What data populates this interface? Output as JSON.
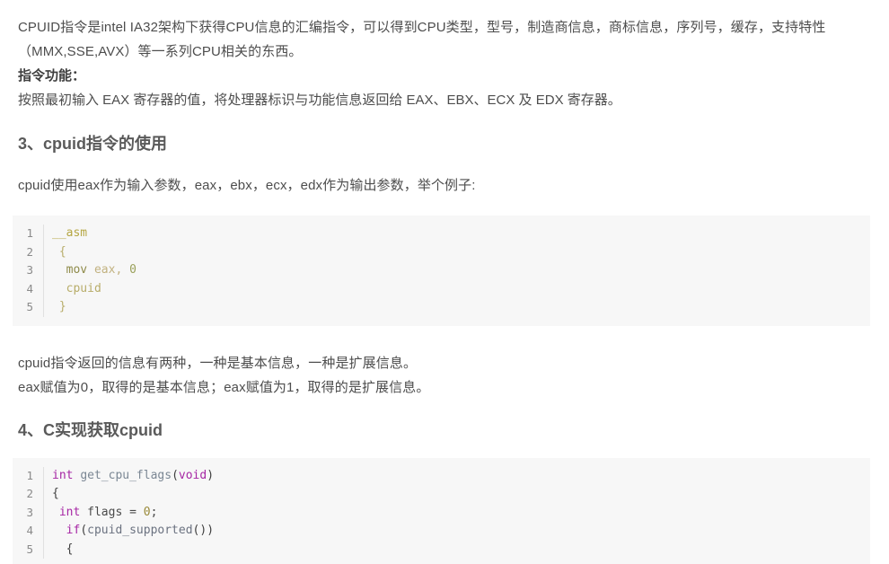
{
  "document": {
    "intro_paragraph": "CPUID指令是intel IA32架构下获得CPU信息的汇编指令，可以得到CPU类型，型号，制造商信息，商标信息，序列号，缓存，支持特性（MMX,SSE,AVX）等一系列CPU相关的东西。",
    "function_label": "指令功能：",
    "function_description": "按照最初输入 EAX 寄存器的值，将处理器标识与功能信息返回给 EAX、EBX、ECX 及 EDX 寄存器。",
    "section3": {
      "heading": "3、cpuid指令的使用",
      "paragraph": "cpuid使用eax作为输入参数，eax，ebx，ecx，edx作为输出参数，举个例子:",
      "code": {
        "language": "asm",
        "lines": [
          {
            "num": "1",
            "tokens": [
              {
                "t": "__asm",
                "c": "tk-asm-pre"
              }
            ]
          },
          {
            "num": "2",
            "tokens": [
              {
                "t": " {",
                "c": "tk-brace"
              }
            ]
          },
          {
            "num": "3",
            "tokens": [
              {
                "t": "  mov ",
                "c": "tk-kw-asm"
              },
              {
                "t": "eax",
                "c": "tk-reg"
              },
              {
                "t": ", ",
                "c": "tk-reg"
              },
              {
                "t": "0",
                "c": "tk-num-asm"
              }
            ]
          },
          {
            "num": "4",
            "tokens": [
              {
                "t": "  cpuid",
                "c": "tk-id-asm"
              }
            ]
          },
          {
            "num": "5",
            "tokens": [
              {
                "t": " }",
                "c": "tk-brace"
              }
            ]
          }
        ]
      },
      "after_code_line1": "cpuid指令返回的信息有两种，一种是基本信息，一种是扩展信息。",
      "after_code_line2": "eax赋值为0，取得的是基本信息；eax赋值为1，取得的是扩展信息。"
    },
    "section4": {
      "heading": "4、C实现获取cpuid",
      "code": {
        "language": "c",
        "lines": [
          {
            "num": "1",
            "tokens": [
              {
                "t": "int ",
                "c": "tk-type"
              },
              {
                "t": "get_cpu_flags",
                "c": "tk-fn"
              },
              {
                "t": "(",
                "c": "tk-punc"
              },
              {
                "t": "void",
                "c": "tk-type"
              },
              {
                "t": ")",
                "c": "tk-punc"
              }
            ]
          },
          {
            "num": "2",
            "tokens": [
              {
                "t": "{",
                "c": "tk-punc"
              }
            ]
          },
          {
            "num": "3",
            "tokens": [
              {
                "t": " ",
                "c": "tk-plain"
              },
              {
                "t": "int ",
                "c": "tk-type"
              },
              {
                "t": "flags ",
                "c": "tk-plain"
              },
              {
                "t": "= ",
                "c": "tk-plain"
              },
              {
                "t": "0",
                "c": "tk-num"
              },
              {
                "t": ";",
                "c": "tk-plain"
              }
            ]
          },
          {
            "num": "4",
            "tokens": [
              {
                "t": "  ",
                "c": "tk-plain"
              },
              {
                "t": "if",
                "c": "tk-kw"
              },
              {
                "t": "(",
                "c": "tk-punc"
              },
              {
                "t": "cpuid_supported",
                "c": "tk-fncall"
              },
              {
                "t": "())",
                "c": "tk-punc"
              }
            ]
          },
          {
            "num": "5",
            "tokens": [
              {
                "t": "  {",
                "c": "tk-punc"
              }
            ]
          }
        ]
      }
    }
  },
  "colors": {
    "page_background": "#ffffff",
    "body_text": "#4d4d4d",
    "heading_text": "#5a5a5a",
    "code_background": "#f7f7f7",
    "gutter_text": "#8a8a8a",
    "gutter_divider": "#e1e1e1",
    "keyword_purple": "#a626a4",
    "function_blue_gray": "#7b8794",
    "asm_khaki": "#b8ad6a"
  }
}
